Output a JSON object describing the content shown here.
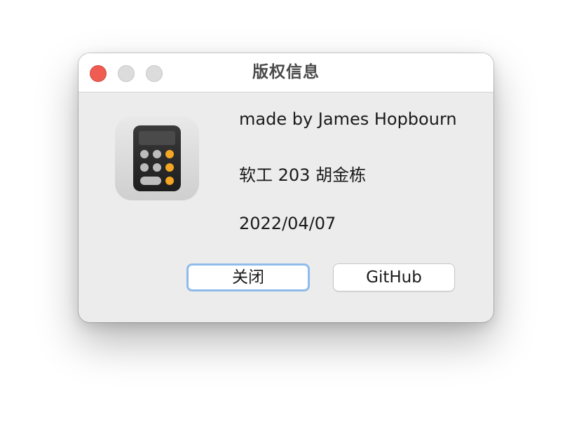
{
  "window": {
    "title": "版权信息"
  },
  "about": {
    "author": "made by James Hopbourn",
    "class_name": "软工 203 胡金栋",
    "date": "2022/04/07"
  },
  "buttons": {
    "close_label": "关闭",
    "github_label": "GitHub"
  },
  "icons": {
    "app": "calculator-icon",
    "traffic_close": "close-traffic-light",
    "traffic_min": "minimize-traffic-light",
    "traffic_max": "zoom-traffic-light"
  },
  "colors": {
    "close_light": "#ee5c52",
    "inactive_light": "#dcdcdc",
    "window_bg": "#ececec",
    "focus_ring": "#8fbbeb",
    "calc_orange": "#f5a623"
  }
}
